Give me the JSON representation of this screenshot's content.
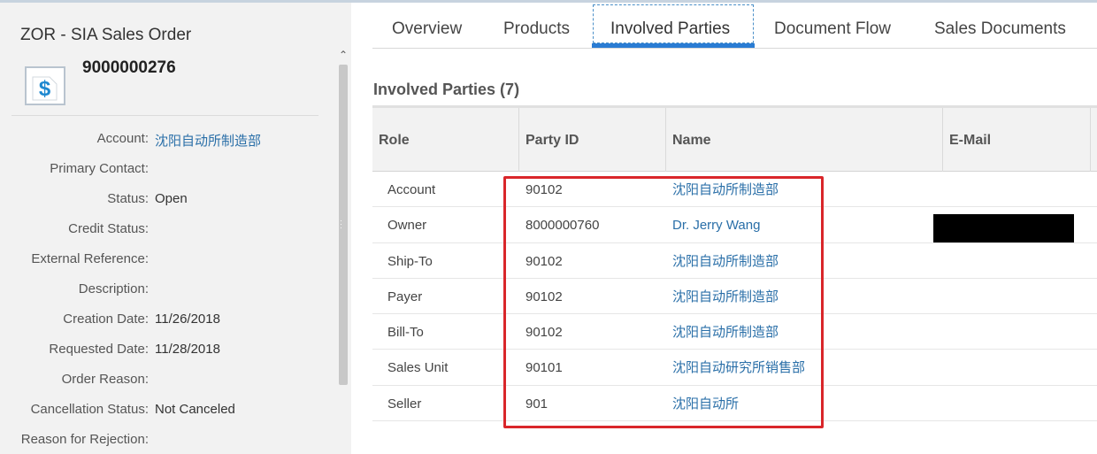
{
  "header": {
    "object_title": "ZOR - SIA Sales Order",
    "object_number": "9000000276",
    "icon": "dollar-document-icon"
  },
  "fields": [
    {
      "label": "Account:",
      "value": "沈阳自动所制造部",
      "link": true
    },
    {
      "label": "Primary Contact:",
      "value": ""
    },
    {
      "label": "Status:",
      "value": "Open"
    },
    {
      "label": "Credit Status:",
      "value": ""
    },
    {
      "label": "External Reference:",
      "value": ""
    },
    {
      "label": "Description:",
      "value": ""
    },
    {
      "label": "Creation Date:",
      "value": "11/26/2018"
    },
    {
      "label": "Requested Date:",
      "value": "11/28/2018"
    },
    {
      "label": "Order Reason:",
      "value": ""
    },
    {
      "label": "Cancellation Status:",
      "value": "Not Canceled"
    },
    {
      "label": "Reason for Rejection:",
      "value": ""
    }
  ],
  "tabs": [
    "Overview",
    "Products",
    "Involved Parties",
    "Document Flow",
    "Sales Documents"
  ],
  "active_tab": "Involved Parties",
  "section_title": "Involved Parties (7)",
  "table": {
    "columns": [
      "Role",
      "Party ID",
      "Name",
      "E-Mail"
    ],
    "rows": [
      {
        "role": "Account",
        "party_id": "90102",
        "name": "沈阳自动所制造部"
      },
      {
        "role": "Owner",
        "party_id": "8000000760",
        "name": "Dr. Jerry Wang"
      },
      {
        "role": "Ship-To",
        "party_id": "90102",
        "name": "沈阳自动所制造部"
      },
      {
        "role": "Payer",
        "party_id": "90102",
        "name": "沈阳自动所制造部"
      },
      {
        "role": "Bill-To",
        "party_id": "90102",
        "name": "沈阳自动所制造部"
      },
      {
        "role": "Sales Unit",
        "party_id": "90101",
        "name": "沈阳自动研究所销售部"
      },
      {
        "role": "Seller",
        "party_id": "901",
        "name": "沈阳自动所"
      }
    ]
  },
  "colors": {
    "link": "#2a6fa8",
    "tab_underline": "#2a7cd3",
    "highlight_box": "#d9262a",
    "redaction": "#000000"
  }
}
